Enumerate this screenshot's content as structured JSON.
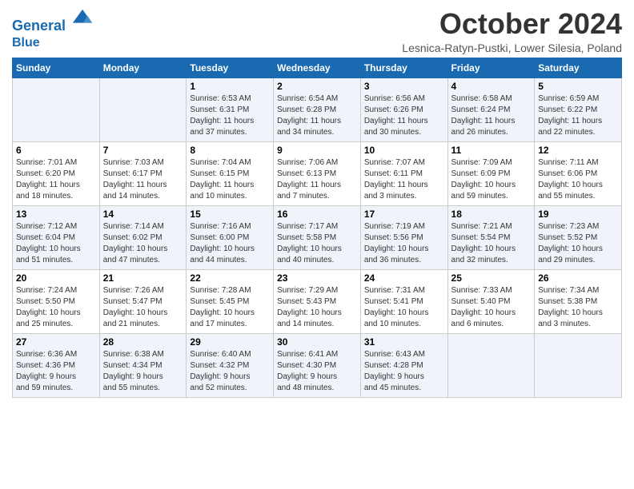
{
  "logo": {
    "line1": "General",
    "line2": "Blue"
  },
  "title": "October 2024",
  "location": "Lesnica-Ratyn-Pustki, Lower Silesia, Poland",
  "weekdays": [
    "Sunday",
    "Monday",
    "Tuesday",
    "Wednesday",
    "Thursday",
    "Friday",
    "Saturday"
  ],
  "weeks": [
    [
      {
        "day": "",
        "info": ""
      },
      {
        "day": "",
        "info": ""
      },
      {
        "day": "1",
        "info": "Sunrise: 6:53 AM\nSunset: 6:31 PM\nDaylight: 11 hours\nand 37 minutes."
      },
      {
        "day": "2",
        "info": "Sunrise: 6:54 AM\nSunset: 6:28 PM\nDaylight: 11 hours\nand 34 minutes."
      },
      {
        "day": "3",
        "info": "Sunrise: 6:56 AM\nSunset: 6:26 PM\nDaylight: 11 hours\nand 30 minutes."
      },
      {
        "day": "4",
        "info": "Sunrise: 6:58 AM\nSunset: 6:24 PM\nDaylight: 11 hours\nand 26 minutes."
      },
      {
        "day": "5",
        "info": "Sunrise: 6:59 AM\nSunset: 6:22 PM\nDaylight: 11 hours\nand 22 minutes."
      }
    ],
    [
      {
        "day": "6",
        "info": "Sunrise: 7:01 AM\nSunset: 6:20 PM\nDaylight: 11 hours\nand 18 minutes."
      },
      {
        "day": "7",
        "info": "Sunrise: 7:03 AM\nSunset: 6:17 PM\nDaylight: 11 hours\nand 14 minutes."
      },
      {
        "day": "8",
        "info": "Sunrise: 7:04 AM\nSunset: 6:15 PM\nDaylight: 11 hours\nand 10 minutes."
      },
      {
        "day": "9",
        "info": "Sunrise: 7:06 AM\nSunset: 6:13 PM\nDaylight: 11 hours\nand 7 minutes."
      },
      {
        "day": "10",
        "info": "Sunrise: 7:07 AM\nSunset: 6:11 PM\nDaylight: 11 hours\nand 3 minutes."
      },
      {
        "day": "11",
        "info": "Sunrise: 7:09 AM\nSunset: 6:09 PM\nDaylight: 10 hours\nand 59 minutes."
      },
      {
        "day": "12",
        "info": "Sunrise: 7:11 AM\nSunset: 6:06 PM\nDaylight: 10 hours\nand 55 minutes."
      }
    ],
    [
      {
        "day": "13",
        "info": "Sunrise: 7:12 AM\nSunset: 6:04 PM\nDaylight: 10 hours\nand 51 minutes."
      },
      {
        "day": "14",
        "info": "Sunrise: 7:14 AM\nSunset: 6:02 PM\nDaylight: 10 hours\nand 47 minutes."
      },
      {
        "day": "15",
        "info": "Sunrise: 7:16 AM\nSunset: 6:00 PM\nDaylight: 10 hours\nand 44 minutes."
      },
      {
        "day": "16",
        "info": "Sunrise: 7:17 AM\nSunset: 5:58 PM\nDaylight: 10 hours\nand 40 minutes."
      },
      {
        "day": "17",
        "info": "Sunrise: 7:19 AM\nSunset: 5:56 PM\nDaylight: 10 hours\nand 36 minutes."
      },
      {
        "day": "18",
        "info": "Sunrise: 7:21 AM\nSunset: 5:54 PM\nDaylight: 10 hours\nand 32 minutes."
      },
      {
        "day": "19",
        "info": "Sunrise: 7:23 AM\nSunset: 5:52 PM\nDaylight: 10 hours\nand 29 minutes."
      }
    ],
    [
      {
        "day": "20",
        "info": "Sunrise: 7:24 AM\nSunset: 5:50 PM\nDaylight: 10 hours\nand 25 minutes."
      },
      {
        "day": "21",
        "info": "Sunrise: 7:26 AM\nSunset: 5:47 PM\nDaylight: 10 hours\nand 21 minutes."
      },
      {
        "day": "22",
        "info": "Sunrise: 7:28 AM\nSunset: 5:45 PM\nDaylight: 10 hours\nand 17 minutes."
      },
      {
        "day": "23",
        "info": "Sunrise: 7:29 AM\nSunset: 5:43 PM\nDaylight: 10 hours\nand 14 minutes."
      },
      {
        "day": "24",
        "info": "Sunrise: 7:31 AM\nSunset: 5:41 PM\nDaylight: 10 hours\nand 10 minutes."
      },
      {
        "day": "25",
        "info": "Sunrise: 7:33 AM\nSunset: 5:40 PM\nDaylight: 10 hours\nand 6 minutes."
      },
      {
        "day": "26",
        "info": "Sunrise: 7:34 AM\nSunset: 5:38 PM\nDaylight: 10 hours\nand 3 minutes."
      }
    ],
    [
      {
        "day": "27",
        "info": "Sunrise: 6:36 AM\nSunset: 4:36 PM\nDaylight: 9 hours\nand 59 minutes."
      },
      {
        "day": "28",
        "info": "Sunrise: 6:38 AM\nSunset: 4:34 PM\nDaylight: 9 hours\nand 55 minutes."
      },
      {
        "day": "29",
        "info": "Sunrise: 6:40 AM\nSunset: 4:32 PM\nDaylight: 9 hours\nand 52 minutes."
      },
      {
        "day": "30",
        "info": "Sunrise: 6:41 AM\nSunset: 4:30 PM\nDaylight: 9 hours\nand 48 minutes."
      },
      {
        "day": "31",
        "info": "Sunrise: 6:43 AM\nSunset: 4:28 PM\nDaylight: 9 hours\nand 45 minutes."
      },
      {
        "day": "",
        "info": ""
      },
      {
        "day": "",
        "info": ""
      }
    ]
  ]
}
